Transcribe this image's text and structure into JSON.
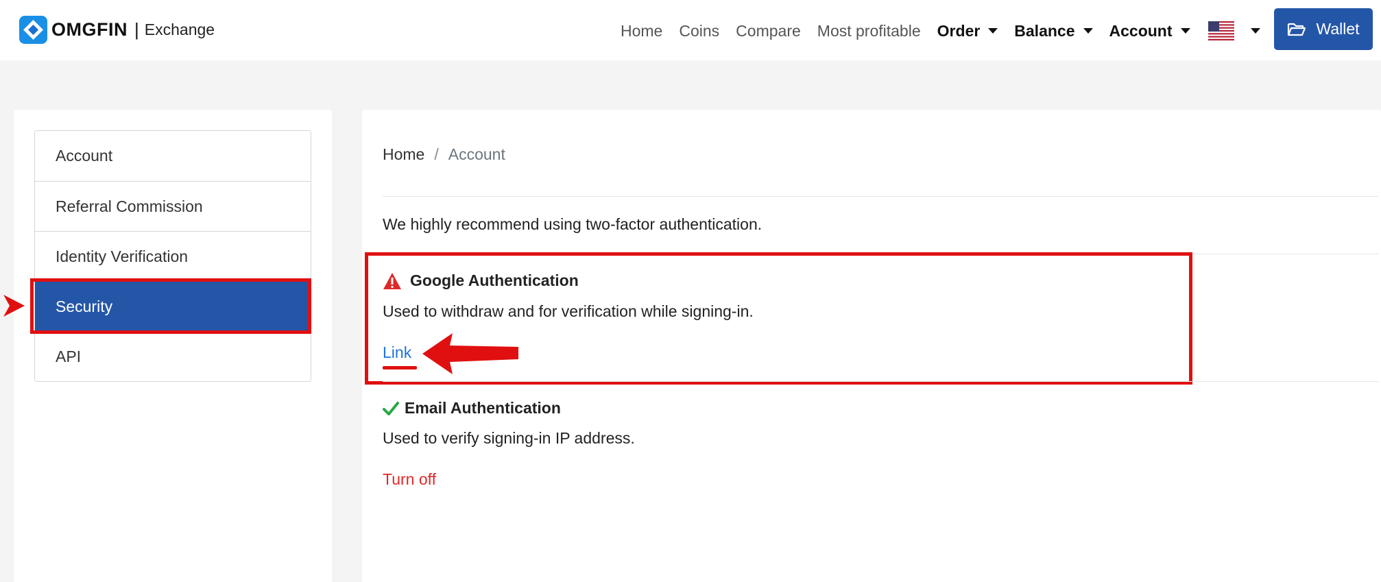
{
  "app": {
    "brand": "OMGFIN",
    "separator": "|",
    "subtitle": "Exchange"
  },
  "nav": {
    "links": [
      "Home",
      "Coins",
      "Compare",
      "Most profitable"
    ],
    "dropdowns": [
      "Order",
      "Balance",
      "Account"
    ],
    "language_flag": "us-flag",
    "wallet_label": "Wallet",
    "wallet_icon": "folder-open-icon"
  },
  "sidebar": {
    "items": [
      {
        "label": "Account",
        "active": false
      },
      {
        "label": "Referral Commission",
        "active": false
      },
      {
        "label": "Identity Verification",
        "active": false
      },
      {
        "label": "Security",
        "active": true
      },
      {
        "label": "API",
        "active": false
      }
    ]
  },
  "breadcrumb": {
    "home": "Home",
    "separator": "/",
    "current": "Account"
  },
  "main": {
    "recommendation": "We highly recommend using two-factor authentication.",
    "google_auth": {
      "icon": "warning-icon",
      "title": "Google Authentication",
      "description": "Used to withdraw and for verification while signing-in.",
      "action": "Link"
    },
    "email_auth": {
      "icon": "checkmark-icon",
      "title": "Email Authentication",
      "description": "Used to verify signing-in IP address.",
      "action": "Turn off"
    }
  },
  "colors": {
    "primary": "#2456a8",
    "link": "#1e73d8",
    "danger": "#e0282a",
    "annotation": "#e01010",
    "success": "#28a745"
  }
}
